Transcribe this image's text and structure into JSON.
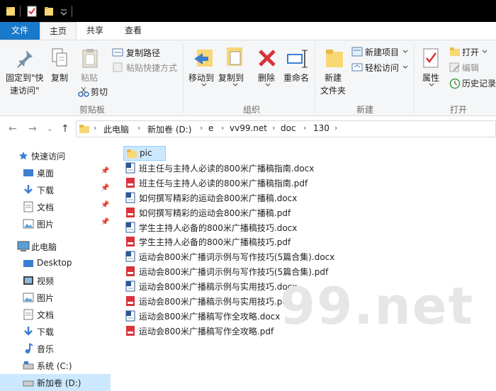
{
  "ribbon_tabs": [
    "文件",
    "主页",
    "共享",
    "查看"
  ],
  "ribbon": {
    "pin_quick": "固定到\"快",
    "pin_quick2": "速访问\"",
    "copy": "复制",
    "paste": "粘贴",
    "copy_path": "复制路径",
    "paste_shortcut": "粘贴快捷方式",
    "cut": "剪切",
    "group_clipboard": "剪贴板",
    "move_to": "移动到",
    "copy_to": "复制到",
    "delete": "删除",
    "rename": "重命名",
    "group_organize": "组织",
    "new_folder": "新建",
    "new_folder2": "文件夹",
    "new_item": "新建项目",
    "easy_access": "轻松访问",
    "group_new": "新建",
    "properties": "属性",
    "open": "打开",
    "edit": "编辑",
    "history": "历史记录",
    "group_open": "打开"
  },
  "breadcrumb": [
    "此电脑",
    "新加卷 (D:)",
    "e",
    "vv99.net",
    "doc",
    "130"
  ],
  "nav": {
    "quick_access": "快速访问",
    "quick_items": [
      "桌面",
      "下载",
      "文档",
      "图片"
    ],
    "this_pc": "此电脑",
    "pc_items": [
      "Desktop",
      "视频",
      "图片",
      "文档",
      "下载",
      "音乐",
      "系统 (C:)",
      "新加卷 (D:)"
    ]
  },
  "files": [
    {
      "name": "pic",
      "type": "folder"
    },
    {
      "name": "班主任与主持人必读的800米广播稿指南.docx",
      "type": "docx"
    },
    {
      "name": "班主任与主持人必读的800米广播稿指南.pdf",
      "type": "pdf"
    },
    {
      "name": "如何撰写精彩的运动会800米广播稿.docx",
      "type": "docx"
    },
    {
      "name": "如何撰写精彩的运动会800米广播稿.pdf",
      "type": "pdf"
    },
    {
      "name": "学生主持人必备的800米广播稿技巧.docx",
      "type": "docx"
    },
    {
      "name": "学生主持人必备的800米广播稿技巧.pdf",
      "type": "pdf"
    },
    {
      "name": "运动会800米广播词示例与写作技巧(5篇合集).docx",
      "type": "docx"
    },
    {
      "name": "运动会800米广播词示例与写作技巧(5篇合集).pdf",
      "type": "pdf"
    },
    {
      "name": "运动会800米广播稿示例与实用技巧.docx",
      "type": "docx"
    },
    {
      "name": "运动会800米广播稿示例与实用技巧.pdf",
      "type": "pdf"
    },
    {
      "name": "运动会800米广播稿写作全攻略.docx",
      "type": "docx"
    },
    {
      "name": "运动会800米广播稿写作全攻略.pdf",
      "type": "pdf"
    }
  ],
  "watermark": "99.net",
  "colors": {
    "file_tab": "#1979ca",
    "selection": "#cce8ff",
    "folder": "#f8d775",
    "pdf": "#d9323b",
    "docx": "#2b5797"
  }
}
